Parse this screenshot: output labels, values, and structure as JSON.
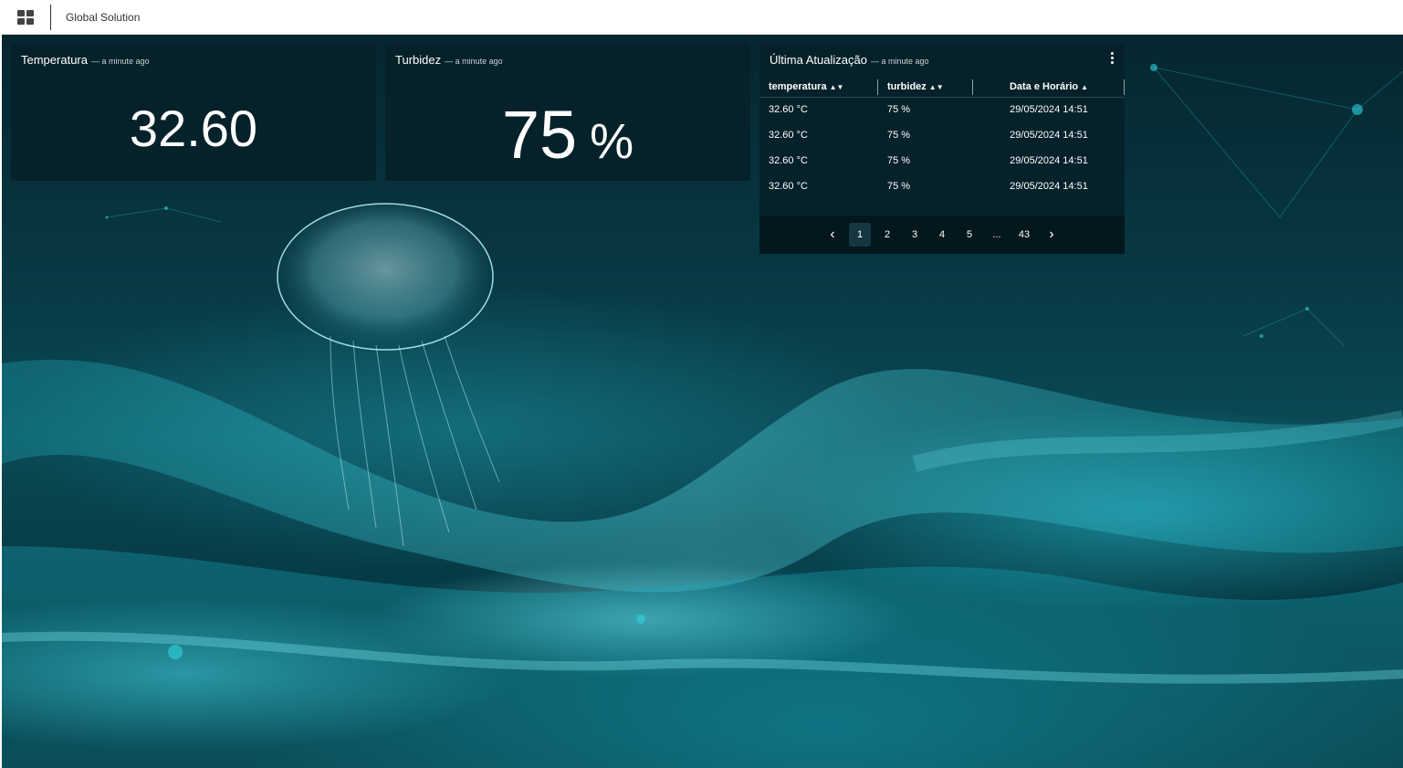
{
  "header": {
    "app_title": "Global Solution",
    "menu_icon": "grid-icon"
  },
  "temperature_card": {
    "title": "Temperatura",
    "updated": "— a minute ago",
    "value": "32.60"
  },
  "turbidity_card": {
    "title": "Turbidez",
    "updated": "— a minute ago",
    "value": "75",
    "unit": "%"
  },
  "table_card": {
    "title": "Última Atualização",
    "updated": "— a minute ago",
    "menu_icon": "kebab-menu-icon",
    "columns": [
      {
        "label": "temperatura",
        "sort": "both"
      },
      {
        "label": "turbidez",
        "sort": "both"
      },
      {
        "label": "Data e Horário",
        "sort": "asc"
      }
    ],
    "rows": [
      [
        "32.60 °C",
        "75 %",
        "29/05/2024 14:51"
      ],
      [
        "32.60 °C",
        "75 %",
        "29/05/2024 14:51"
      ],
      [
        "32.60 °C",
        "75 %",
        "29/05/2024 14:51"
      ],
      [
        "32.60 °C",
        "75 %",
        "29/05/2024 14:51"
      ]
    ],
    "pagination": {
      "prev": "‹",
      "pages": [
        "1",
        "2",
        "3",
        "4",
        "5",
        "...",
        "43"
      ],
      "active": "1",
      "next": "›"
    }
  },
  "colors": {
    "accent": "#2fd4e0",
    "card_bg": "#062028",
    "background": "#0a4a55"
  }
}
